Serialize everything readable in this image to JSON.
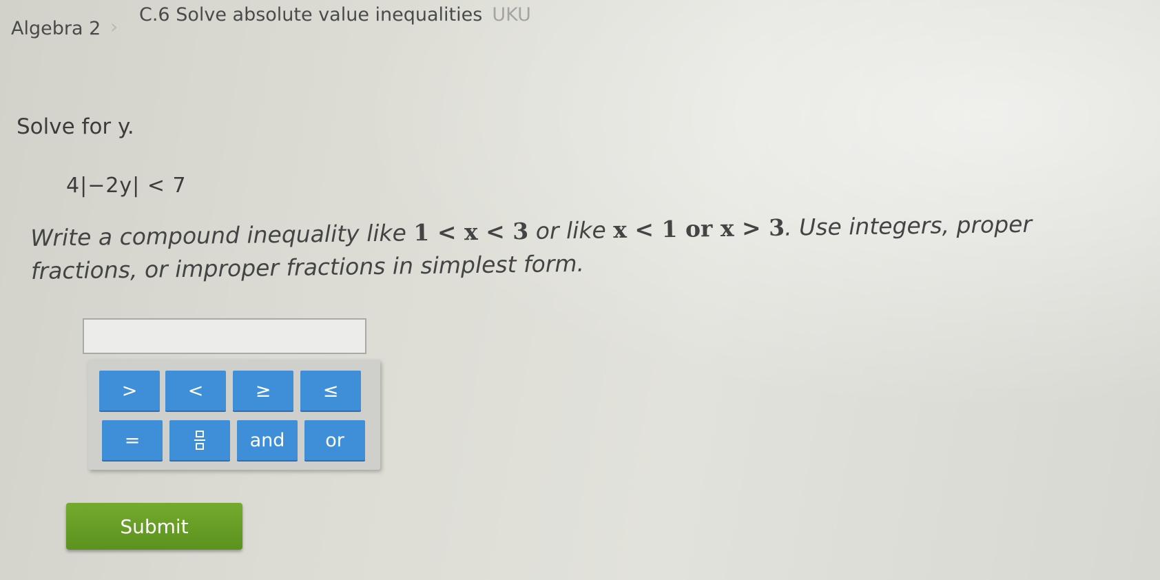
{
  "breadcrumb": {
    "parent": "Algebra 2",
    "separator": "›",
    "current": "C.6 Solve absolute value inequalities",
    "code": "UKU"
  },
  "question": {
    "prompt": "Solve for y.",
    "equation": "4|−2y| < 7",
    "instructions": {
      "part1": "Write a compound inequality like ",
      "example1": "1 < x < 3",
      "part2": " or like ",
      "example2": "x < 1 or x > 3",
      "part3": ". Use integers, proper fractions, or improper fractions in simplest form."
    }
  },
  "answer": {
    "value": "",
    "placeholder": ""
  },
  "keypad": {
    "keys": [
      ">",
      "<",
      "≥",
      "≤",
      "=",
      "fraction",
      "and",
      "or"
    ]
  },
  "submit": {
    "label": "Submit"
  },
  "colors": {
    "key_blue": "#3f8fd8",
    "submit_green": "#68a026"
  }
}
